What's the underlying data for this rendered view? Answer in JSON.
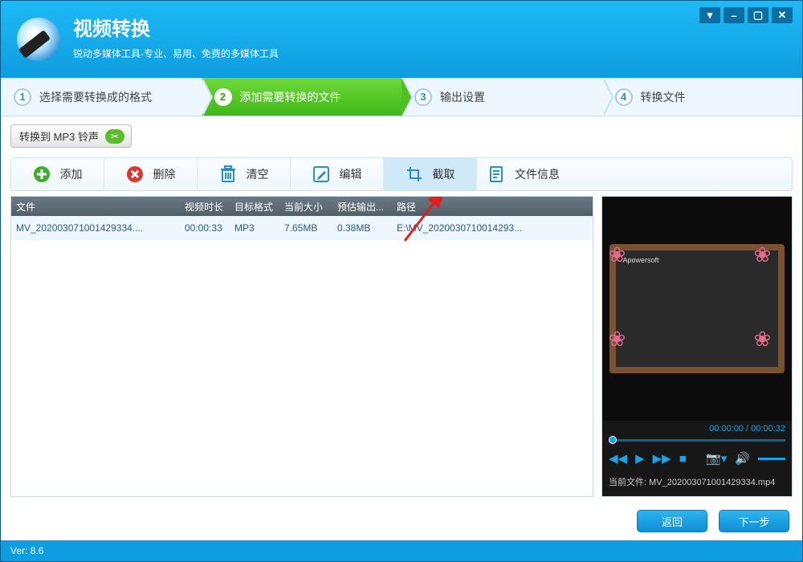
{
  "header": {
    "title": "视频转换",
    "subtitle": "锐动多媒体工具-专业、易用、免费的多媒体工具"
  },
  "steps": [
    {
      "num": "1",
      "label": "选择需要转换成的格式"
    },
    {
      "num": "2",
      "label": "添加需要转换的文件"
    },
    {
      "num": "3",
      "label": "输出设置"
    },
    {
      "num": "4",
      "label": "转换文件"
    }
  ],
  "convert_pill": "转换到 MP3 铃声",
  "actions": {
    "add": "添加",
    "delete": "删除",
    "clear": "清空",
    "edit": "编辑",
    "cut": "截取",
    "info": "文件信息"
  },
  "table": {
    "headers": {
      "file": "文件",
      "duration": "视频时长",
      "format": "目标格式",
      "size": "当前大小",
      "est": "预估输出...",
      "path": "路径"
    },
    "rows": [
      {
        "file": "MV_202003071001429334....",
        "duration": "00:00:33",
        "format": "MP3",
        "size": "7.65MB",
        "est": "0.38MB",
        "path": "E:\\MV_2020030710014293..."
      }
    ]
  },
  "preview": {
    "time_current": "00:00:00",
    "time_total": "00:00:32",
    "current_file_label": "当前文件:",
    "current_file": "MV_202003071001429334.mp4",
    "watermark": "Apowersoft"
  },
  "footer": {
    "back": "返回",
    "next": "下一步"
  },
  "version": "Ver: 8.6"
}
